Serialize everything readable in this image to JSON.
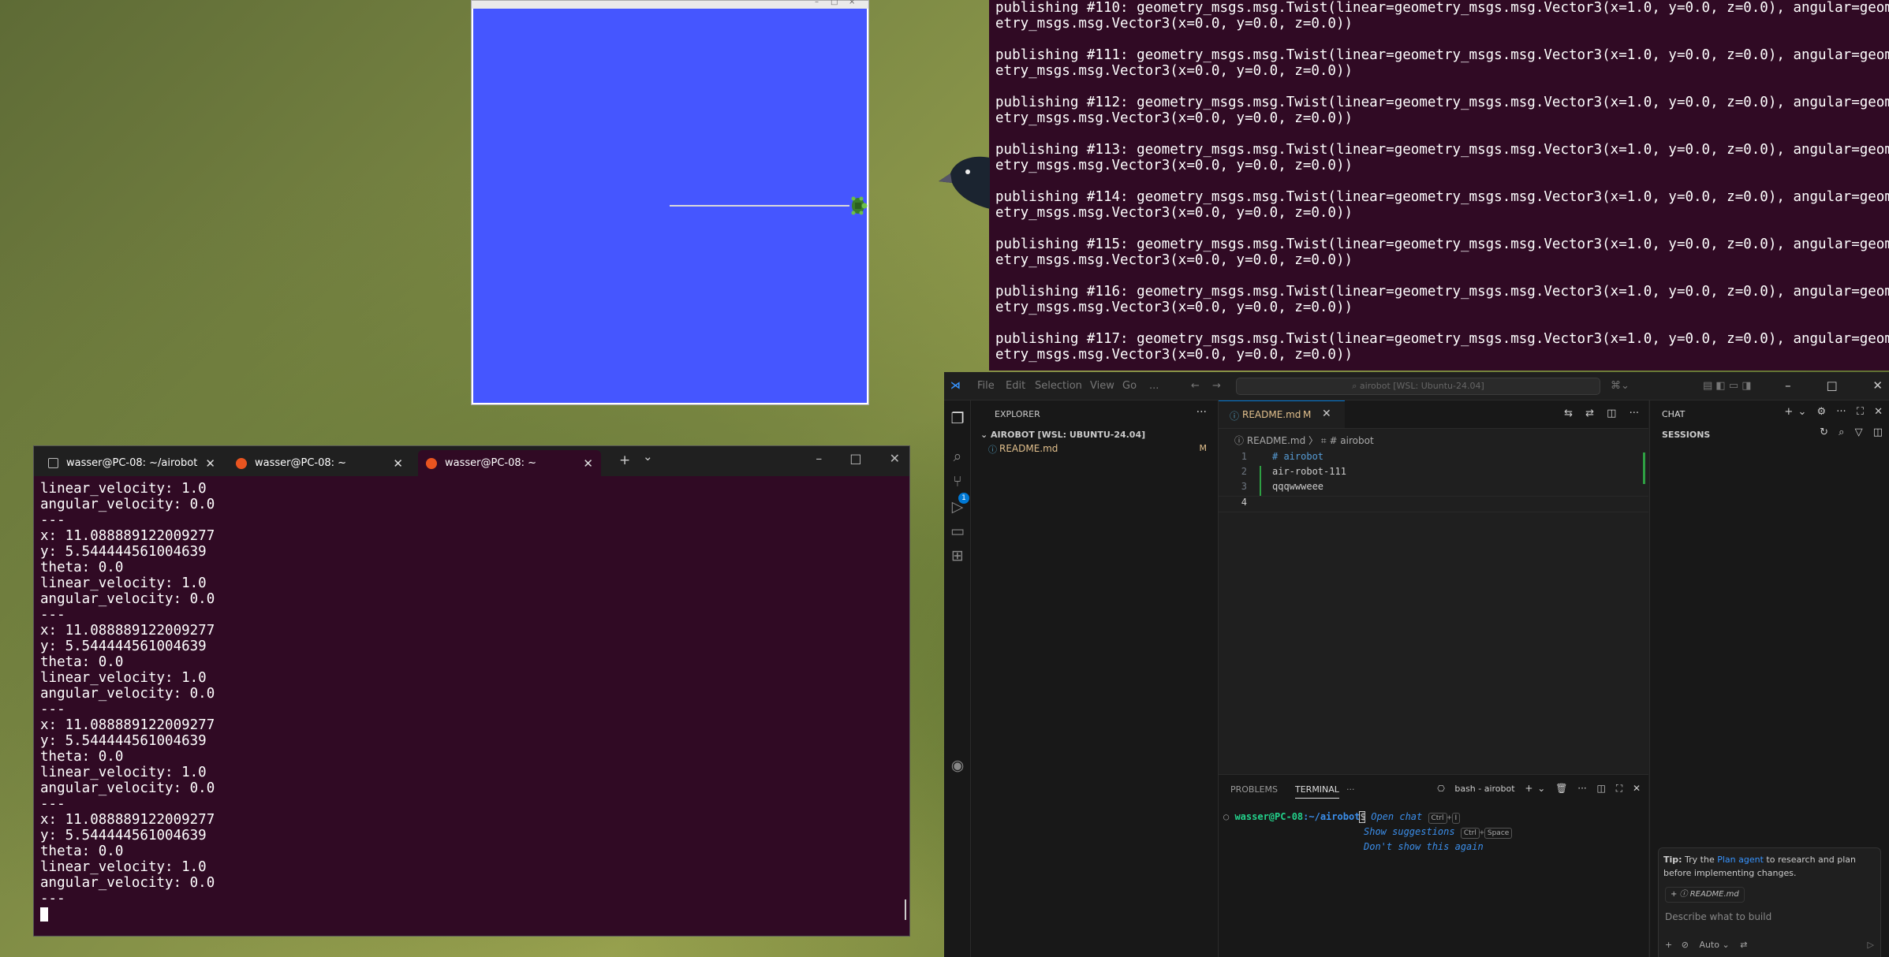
{
  "turtlesim": {
    "title_controls": [
      "–",
      "□",
      "×"
    ]
  },
  "publisher_terminal": {
    "lines": [
      "publishing #110: geometry_msgs.msg.Twist(linear=geometry_msgs.msg.Vector3(x=1.0, y=0.0, z=0.0), angular=geom",
      "etry_msgs.msg.Vector3(x=0.0, y=0.0, z=0.0))",
      "",
      "publishing #111: geometry_msgs.msg.Twist(linear=geometry_msgs.msg.Vector3(x=1.0, y=0.0, z=0.0), angular=geom",
      "etry_msgs.msg.Vector3(x=0.0, y=0.0, z=0.0))",
      "",
      "publishing #112: geometry_msgs.msg.Twist(linear=geometry_msgs.msg.Vector3(x=1.0, y=0.0, z=0.0), angular=geom",
      "etry_msgs.msg.Vector3(x=0.0, y=0.0, z=0.0))",
      "",
      "publishing #113: geometry_msgs.msg.Twist(linear=geometry_msgs.msg.Vector3(x=1.0, y=0.0, z=0.0), angular=geom",
      "etry_msgs.msg.Vector3(x=0.0, y=0.0, z=0.0))",
      "",
      "publishing #114: geometry_msgs.msg.Twist(linear=geometry_msgs.msg.Vector3(x=1.0, y=0.0, z=0.0), angular=geom",
      "etry_msgs.msg.Vector3(x=0.0, y=0.0, z=0.0))",
      "",
      "publishing #115: geometry_msgs.msg.Twist(linear=geometry_msgs.msg.Vector3(x=1.0, y=0.0, z=0.0), angular=geom",
      "etry_msgs.msg.Vector3(x=0.0, y=0.0, z=0.0))",
      "",
      "publishing #116: geometry_msgs.msg.Twist(linear=geometry_msgs.msg.Vector3(x=1.0, y=0.0, z=0.0), angular=geom",
      "etry_msgs.msg.Vector3(x=0.0, y=0.0, z=0.0))",
      "",
      "publishing #117: geometry_msgs.msg.Twist(linear=geometry_msgs.msg.Vector3(x=1.0, y=0.0, z=0.0), angular=geom",
      "etry_msgs.msg.Vector3(x=0.0, y=0.0, z=0.0))"
    ]
  },
  "windows_terminal": {
    "tabs": [
      {
        "label": "wasser@PC-08: ~/airobot",
        "icon": "terminal-icon"
      },
      {
        "label": "wasser@PC-08: ~",
        "icon": "ubuntu-icon"
      },
      {
        "label": "wasser@PC-08: ~",
        "icon": "ubuntu-icon",
        "active": true
      }
    ],
    "new_tab": "+",
    "dropdown": "⌄",
    "window_controls": [
      "–",
      "□",
      "✕"
    ],
    "close_glyph": "✕",
    "lines": [
      "linear_velocity: 1.0",
      "angular_velocity: 0.0",
      "---",
      "x: 11.088889122009277",
      "y: 5.544444561004639",
      "theta: 0.0",
      "linear_velocity: 1.0",
      "angular_velocity: 0.0",
      "---",
      "x: 11.088889122009277",
      "y: 5.544444561004639",
      "theta: 0.0",
      "linear_velocity: 1.0",
      "angular_velocity: 0.0",
      "---",
      "x: 11.088889122009277",
      "y: 5.544444561004639",
      "theta: 0.0",
      "linear_velocity: 1.0",
      "angular_velocity: 0.0",
      "---",
      "x: 11.088889122009277",
      "y: 5.544444561004639",
      "theta: 0.0",
      "linear_velocity: 1.0",
      "angular_velocity: 0.0",
      "---"
    ]
  },
  "vscode": {
    "menu": [
      "File",
      "Edit",
      "Selection",
      "View",
      "Go",
      "..."
    ],
    "search": "airobot [WSL: Ubuntu-24.04]",
    "window_controls": [
      "–",
      "□",
      "✕"
    ],
    "explorer_header": "EXPLORER",
    "explorer_more": "···",
    "folder": "AIROBOT [WSL: UBUNTU-24.04]",
    "file": {
      "name": "README.md",
      "status": "M",
      "icon": "ⓘ"
    },
    "scm_badge": "1",
    "tab": {
      "label": "README.md",
      "modified": "M",
      "close": "✕",
      "icon": "ⓘ"
    },
    "breadcrumb": "ⓘ README.md 〉 ⌗ # airobot",
    "editor_actions": [
      "⇆",
      "⇄",
      "◫",
      "···"
    ],
    "code_lines": [
      {
        "n": "1",
        "text": "# airobot"
      },
      {
        "n": "2",
        "text": "air-robot-111"
      },
      {
        "n": "3",
        "text": "qqqwwweee"
      },
      {
        "n": "4",
        "text": ""
      }
    ],
    "panel": {
      "tabs": [
        "PROBLEMS",
        "TERMINAL",
        "···"
      ],
      "shell": "bash - airobot",
      "tools": [
        "+",
        "⌄",
        "🗑",
        "···",
        "◫",
        "⛶",
        "✕"
      ],
      "prompt_user": "wasser@PC-08",
      "prompt_path": ":~/airobot",
      "prompt_symbol": "$",
      "hint1": "Open chat",
      "hint1_keys": [
        "Ctrl",
        "+",
        "I"
      ],
      "hint2": "Show suggestions",
      "hint2_keys": [
        "Ctrl",
        "+",
        "Space"
      ],
      "hint3": "Don't show this again"
    },
    "chat": {
      "title": "CHAT",
      "sessions": "SESSIONS",
      "tools": [
        "+",
        "⌄",
        "⚙",
        "···",
        "⛶",
        "✕"
      ],
      "session_tools": [
        "↻",
        "⌕",
        "▽",
        "◫"
      ],
      "tip_prefix": "Tip:",
      "tip_text1": " Try the ",
      "tip_link": "Plan agent",
      "tip_text2": " to research and plan before implementing changes.",
      "attachment": "+ ⓘ README.md",
      "input_placeholder": "Describe what to build",
      "mode": "Auto",
      "send": "▷"
    }
  }
}
